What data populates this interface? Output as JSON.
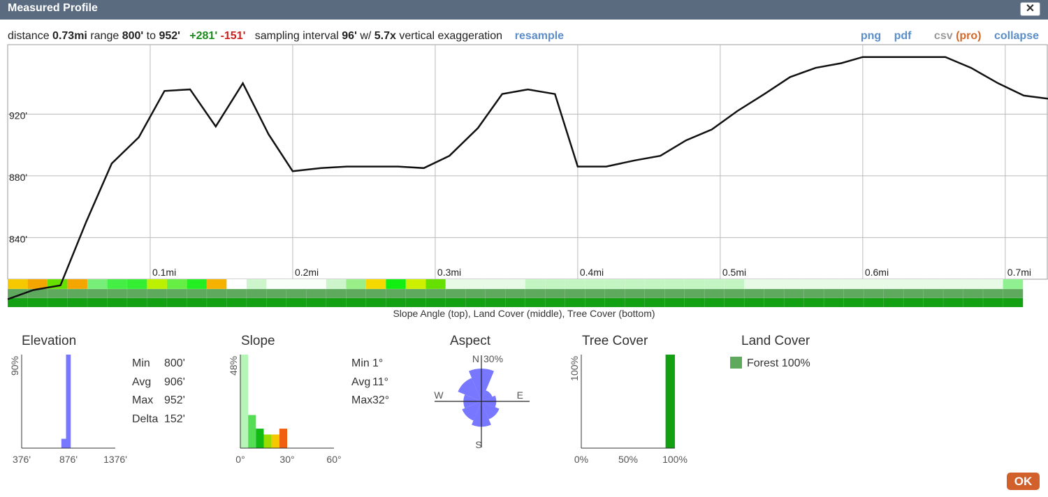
{
  "window": {
    "title": "Measured Profile",
    "close_label": "✕"
  },
  "info": {
    "distance_label": "distance",
    "distance": "0.73mi",
    "range_label": "range",
    "range_min": "800'",
    "range_to": "to",
    "range_max": "952'",
    "gain": "+281'",
    "loss": "-151'",
    "sampling_label": "sampling interval",
    "sampling": "96'",
    "w_label": "w/",
    "exaggeration": "5.7x",
    "exaggeration_label": "vertical exaggeration",
    "resample": "resample"
  },
  "links": {
    "png": "png",
    "pdf": "pdf",
    "csv": "csv",
    "pro": "(pro)",
    "collapse": "collapse"
  },
  "chart_data": [
    {
      "type": "line",
      "name": "elevation-profile",
      "x_unit": "mi",
      "y_unit": "ft",
      "xlim": [
        0,
        0.73
      ],
      "ylim": [
        813,
        965
      ],
      "x_ticks": [
        "0.1mi",
        "0.2mi",
        "0.3mi",
        "0.4mi",
        "0.5mi",
        "0.6mi",
        "0.7mi"
      ],
      "x_tick_values": [
        0.1,
        0.2,
        0.3,
        0.4,
        0.5,
        0.6,
        0.7
      ],
      "y_ticks": [
        "920'",
        "880'",
        "840'"
      ],
      "y_tick_values": [
        920,
        880,
        840
      ],
      "x": [
        0,
        0.018,
        0.037,
        0.055,
        0.073,
        0.092,
        0.11,
        0.128,
        0.146,
        0.165,
        0.183,
        0.2,
        0.22,
        0.238,
        0.256,
        0.274,
        0.292,
        0.31,
        0.33,
        0.347,
        0.365,
        0.384,
        0.4,
        0.42,
        0.44,
        0.458,
        0.476,
        0.494,
        0.512,
        0.531,
        0.549,
        0.567,
        0.585,
        0.6,
        0.622,
        0.64,
        0.658,
        0.676,
        0.695,
        0.713,
        0.73
      ],
      "y": [
        800,
        806,
        809,
        850,
        888,
        905,
        935,
        936,
        912,
        940,
        907,
        883,
        885,
        886,
        886,
        886,
        885,
        893,
        911,
        933,
        936,
        933,
        886,
        886,
        890,
        893,
        903,
        910,
        922,
        933,
        944,
        950,
        953,
        957,
        957,
        957,
        957,
        950,
        940,
        932,
        930
      ]
    },
    {
      "type": "heatmap",
      "name": "profile-strips",
      "rows": [
        "Slope Angle (top)",
        "Land Cover (middle)",
        "Tree Cover (bottom)"
      ],
      "slope_colors": [
        "#f5c800",
        "#f5a500",
        "#66e000",
        "#f5a500",
        "#77ee77",
        "#44ee44",
        "#33ee33",
        "#bbf000",
        "#66ee44",
        "#22ee22",
        "#f5b200",
        "#ffffff",
        "#ccf5cc",
        "#f8fff8",
        "#f8fff8",
        "#f8fff8",
        "#ccf5cc",
        "#99ee88",
        "#f5d800",
        "#11ee11",
        "#cdf000",
        "#66e000",
        "#e6fae6",
        "#e6fae6",
        "#e6fae6",
        "#e6fae6",
        "#c2f5c2",
        "#c2f5c2",
        "#c2f5c2",
        "#c2f5c2",
        "#c2f5c2",
        "#c2f5c2",
        "#c2f5c2",
        "#c2f5c2",
        "#c2f5c2",
        "#c2f5c2",
        "#c2f5c2",
        "#e6fae6",
        "#e6fae6",
        "#e6fae6",
        "#e6fae6",
        "#e6fae6",
        "#e6fae6",
        "#e6fae6",
        "#e6fae6",
        "#e6fae6",
        "#e6fae6",
        "#e6fae6",
        "#e6fae6",
        "#e6fae6",
        "#8ef08e"
      ],
      "land_cover_color": "#5ea95e",
      "tree_cover_color": "#13a013"
    },
    {
      "type": "bar",
      "name": "elevation-histogram",
      "title": "Elevation",
      "ylabel": "90%",
      "x_ticks": [
        "376'",
        "876'",
        "1376'"
      ],
      "xlim": [
        376,
        1376
      ],
      "ylim": [
        0,
        90
      ],
      "bars": [
        {
          "from": 800,
          "to": 850,
          "value": 9
        },
        {
          "from": 850,
          "to": 900,
          "value": 90
        }
      ],
      "color": "#7777ff"
    },
    {
      "type": "bar",
      "name": "slope-histogram",
      "title": "Slope",
      "ylabel": "48%",
      "x_ticks": [
        "0°",
        "30°",
        "60°"
      ],
      "xlim": [
        0,
        60
      ],
      "ylim": [
        0,
        48
      ],
      "bars": [
        {
          "from": 0,
          "to": 5,
          "value": 48,
          "color": "#b5f5b5"
        },
        {
          "from": 5,
          "to": 10,
          "value": 17,
          "color": "#55dd55"
        },
        {
          "from": 10,
          "to": 15,
          "value": 10,
          "color": "#11bb11"
        },
        {
          "from": 15,
          "to": 20,
          "value": 7,
          "color": "#99dd00"
        },
        {
          "from": 20,
          "to": 25,
          "value": 7,
          "color": "#f5c800"
        },
        {
          "from": 25,
          "to": 30,
          "value": 10,
          "color": "#f06010"
        }
      ]
    },
    {
      "type": "pie",
      "name": "aspect-rose",
      "title": "Aspect",
      "scale_label": "30%",
      "scale_value": 30,
      "labels": [
        "N",
        "E",
        "S",
        "W"
      ],
      "directions": [
        "N",
        "NE",
        "E",
        "SE",
        "S",
        "SW",
        "W",
        "NW"
      ],
      "values": [
        22,
        8,
        10,
        13,
        17,
        14,
        12,
        17
      ],
      "color": "#7777ff"
    },
    {
      "type": "bar",
      "name": "tree-cover-histogram",
      "title": "Tree Cover",
      "ylabel": "100%",
      "x_ticks": [
        "0%",
        "50%",
        "100%"
      ],
      "xlim": [
        0,
        100
      ],
      "ylim": [
        0,
        100
      ],
      "bars": [
        {
          "from": 90,
          "to": 100,
          "value": 100
        }
      ],
      "color": "#13a013"
    }
  ],
  "strip_caption": "Slope Angle (top), Land Cover (middle), Tree Cover (bottom)",
  "elevation_stats": [
    {
      "label": "Min",
      "value": "800'"
    },
    {
      "label": "Avg",
      "value": "906'"
    },
    {
      "label": "Max",
      "value": "952'"
    },
    {
      "label": "Delta",
      "value": "152'"
    }
  ],
  "slope_stats": [
    {
      "label": "Min",
      "value": "1°"
    },
    {
      "label": "Avg",
      "value": "11°"
    },
    {
      "label": "Max",
      "value": "32°"
    }
  ],
  "land_cover": {
    "title": "Land Cover",
    "item": "Forest 100%",
    "color": "#5ea95e"
  },
  "ok_label": "OK"
}
